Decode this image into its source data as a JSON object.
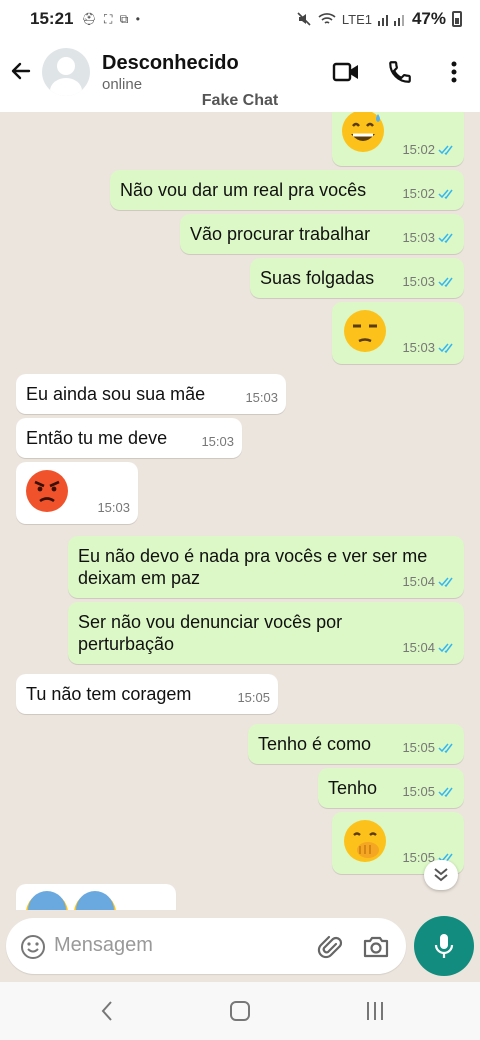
{
  "status_bar": {
    "time": "15:21",
    "notif_icons": "⛑ ⛶ ⧉ •",
    "network": "LTE1",
    "battery": "47%"
  },
  "header": {
    "contact_name": "Desconhecido",
    "contact_status": "online",
    "overlay_label": "Fake Chat"
  },
  "messages": [
    {
      "dir": "out",
      "kind": "emoji",
      "emoji": "grinning-sweat",
      "time": "15:02",
      "read": true
    },
    {
      "dir": "out",
      "kind": "text",
      "text": "Não vou dar um real pra vocês",
      "time": "15:02",
      "read": true
    },
    {
      "dir": "out",
      "kind": "text",
      "text": "Vão procurar trabalhar",
      "time": "15:03",
      "read": true
    },
    {
      "dir": "out",
      "kind": "text",
      "text": "Suas folgadas",
      "time": "15:03",
      "read": true
    },
    {
      "dir": "out",
      "kind": "emoji",
      "emoji": "unamused",
      "time": "15:03",
      "read": true
    },
    {
      "dir": "in",
      "kind": "text",
      "text": "Eu ainda sou sua mãe",
      "time": "15:03"
    },
    {
      "dir": "in",
      "kind": "text",
      "text": "Então tu me deve",
      "time": "15:03"
    },
    {
      "dir": "in",
      "kind": "emoji",
      "emoji": "angry",
      "time": "15:03"
    },
    {
      "dir": "out",
      "kind": "text",
      "text": "Eu não devo é nada pra vocês e ver ser me deixam em paz",
      "time": "15:04",
      "read": true
    },
    {
      "dir": "out",
      "kind": "text",
      "text": "Ser não vou denunciar vocês por perturbação",
      "time": "15:04",
      "read": true
    },
    {
      "dir": "in",
      "kind": "text",
      "text": "Tu não tem coragem",
      "time": "15:05"
    },
    {
      "dir": "out",
      "kind": "text",
      "text": "Tenho é como",
      "time": "15:05",
      "read": true
    },
    {
      "dir": "out",
      "kind": "text",
      "text": "Tenho",
      "time": "15:05",
      "read": true
    },
    {
      "dir": "out",
      "kind": "emoji",
      "emoji": "hand-over-mouth",
      "time": "15:05",
      "read": true
    },
    {
      "dir": "in",
      "kind": "emoji",
      "emoji": "cold-sweat-pair",
      "time": ""
    }
  ],
  "input": {
    "placeholder": "Mensagem"
  },
  "icons": {
    "back": "arrow-left-icon",
    "video": "video-call-icon",
    "call": "phone-icon",
    "menu": "more-vert-icon",
    "emoji": "emoji-icon",
    "attach": "paperclip-icon",
    "camera": "camera-icon",
    "mic": "mic-icon",
    "scroll": "chevron-double-down-icon"
  },
  "colors": {
    "outgoing_bubble": "#dcf8c6",
    "incoming_bubble": "#ffffff",
    "chat_bg": "#ece5dd",
    "accent": "#128c7e",
    "read_tick": "#34b7f1"
  }
}
